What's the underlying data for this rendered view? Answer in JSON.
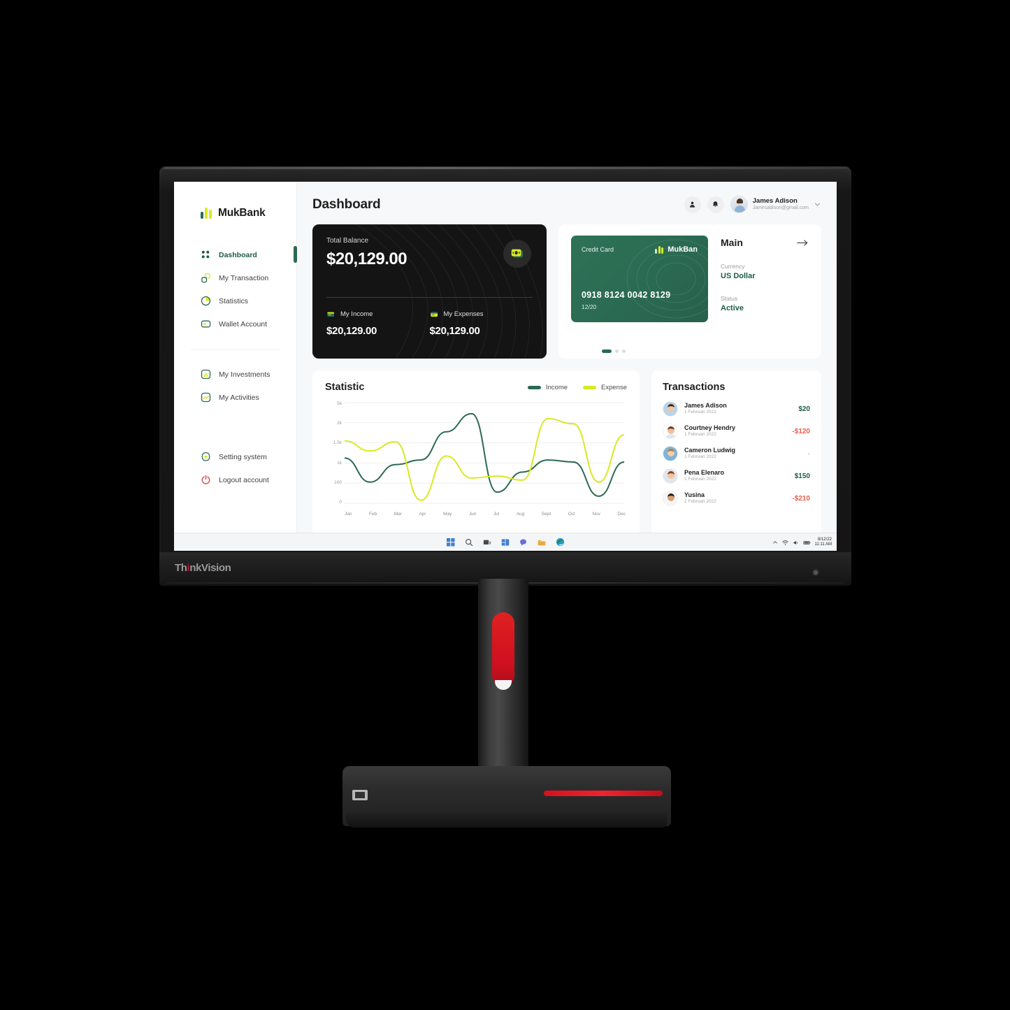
{
  "monitor": {
    "brand_label": "ThinkVision",
    "brand_prefix": "Th",
    "brand_dot": "i",
    "brand_suffix": "nkVision"
  },
  "sidebar": {
    "brand": "MukBank",
    "items": [
      {
        "label": "Dashboard",
        "icon": "grid-icon",
        "active": true
      },
      {
        "label": "My Transaction",
        "icon": "transaction-icon",
        "active": false
      },
      {
        "label": "Statistics",
        "icon": "pie-chart-icon",
        "active": false
      },
      {
        "label": "Wallet Account",
        "icon": "wallet-icon",
        "active": false
      }
    ],
    "items2": [
      {
        "label": "My Investments",
        "icon": "bar-chart-icon"
      },
      {
        "label": "My Activities",
        "icon": "activity-icon"
      }
    ],
    "bottom": [
      {
        "label": "Setting system",
        "icon": "gear-icon"
      },
      {
        "label": "Logout account",
        "icon": "logout-icon"
      }
    ]
  },
  "header": {
    "title": "Dashboard",
    "user_name": "James Adison",
    "user_email": "Jamesadison@gmail.com",
    "icons": [
      "person-icon",
      "bell-icon",
      "chevron-down-icon"
    ]
  },
  "balance": {
    "label": "Total Balance",
    "amount": "$20,129.00",
    "icon": "money-icon",
    "income_label": "My Income",
    "income_amount": "$20,129.00",
    "expenses_label": "My Expenses",
    "expenses_amount": "$20,129.00"
  },
  "credit_card": {
    "label": "Credit Card",
    "brand": "MukBan",
    "number": "0918 8124 0042 8129",
    "expiry": "12/20",
    "title": "Main",
    "currency_label": "Currency",
    "currency_value": "US Dollar",
    "status_label": "Status",
    "status_value": "Active",
    "dots": 3,
    "active_dot": 0
  },
  "statistic": {
    "title": "Statistic",
    "legend": [
      {
        "name": "Income",
        "color": "#2b6a52"
      },
      {
        "name": "Expense",
        "color": "#d7ea22"
      }
    ]
  },
  "chart_data": {
    "type": "line",
    "title": "Statistic",
    "xlabel": "",
    "ylabel": "",
    "categories": [
      "Jan",
      "Feb",
      "Mar",
      "Apr",
      "May",
      "Jun",
      "Jul",
      "Aug",
      "Sept",
      "Oct",
      "Nov",
      "Dec"
    ],
    "ytick_labels": [
      "5k",
      "2k",
      "1.5k",
      "1k",
      "100",
      "0"
    ],
    "ytick_positions": [
      5,
      4,
      3,
      2,
      1,
      0
    ],
    "ylim": [
      0,
      5
    ],
    "grid": true,
    "legend_position": "top-right",
    "series": [
      {
        "name": "Income",
        "color": "#2b6a52",
        "values": [
          2.25,
          1.05,
          1.92,
          2.15,
          3.55,
          4.45,
          0.55,
          1.55,
          2.15,
          2.05,
          0.35,
          2.05
        ]
      },
      {
        "name": "Expense",
        "color": "#d7ea22",
        "values": [
          3.1,
          2.6,
          3.05,
          0.15,
          2.35,
          1.25,
          1.35,
          1.15,
          4.2,
          3.95,
          1.05,
          3.4
        ]
      }
    ]
  },
  "transactions": {
    "title": "Transactions",
    "rows": [
      {
        "name": "James Adison",
        "date": "1 Februari 2022",
        "amount": "$20",
        "type": "pos"
      },
      {
        "name": "Courtney Hendry",
        "date": "1 Februari 2022",
        "amount": "-$120",
        "type": "neg"
      },
      {
        "name": "Cameron Ludwig",
        "date": "1 Februari 2022",
        "amount": "-",
        "type": "muted"
      },
      {
        "name": "Pena Elenaro",
        "date": "1 Februari 2022",
        "amount": "$150",
        "type": "pos"
      },
      {
        "name": "Yusina",
        "date": "1 Februari 2022",
        "amount": "-$210",
        "type": "neg"
      }
    ]
  },
  "taskbar": {
    "apps": [
      "start-icon",
      "search-icon",
      "task-view-icon",
      "widgets-icon",
      "chat-icon",
      "file-explorer-icon",
      "edge-icon"
    ],
    "tray": [
      "chevron-up-icon",
      "wifi-icon",
      "volume-icon",
      "battery-icon"
    ],
    "date": "8/12/22",
    "time": "11:11 AM"
  },
  "colors": {
    "brand_green": "#2b6a52",
    "brand_yellow": "#d7ea22",
    "positive": "#1d5c43",
    "negative": "#f0594a",
    "dark_card": "#141414"
  }
}
